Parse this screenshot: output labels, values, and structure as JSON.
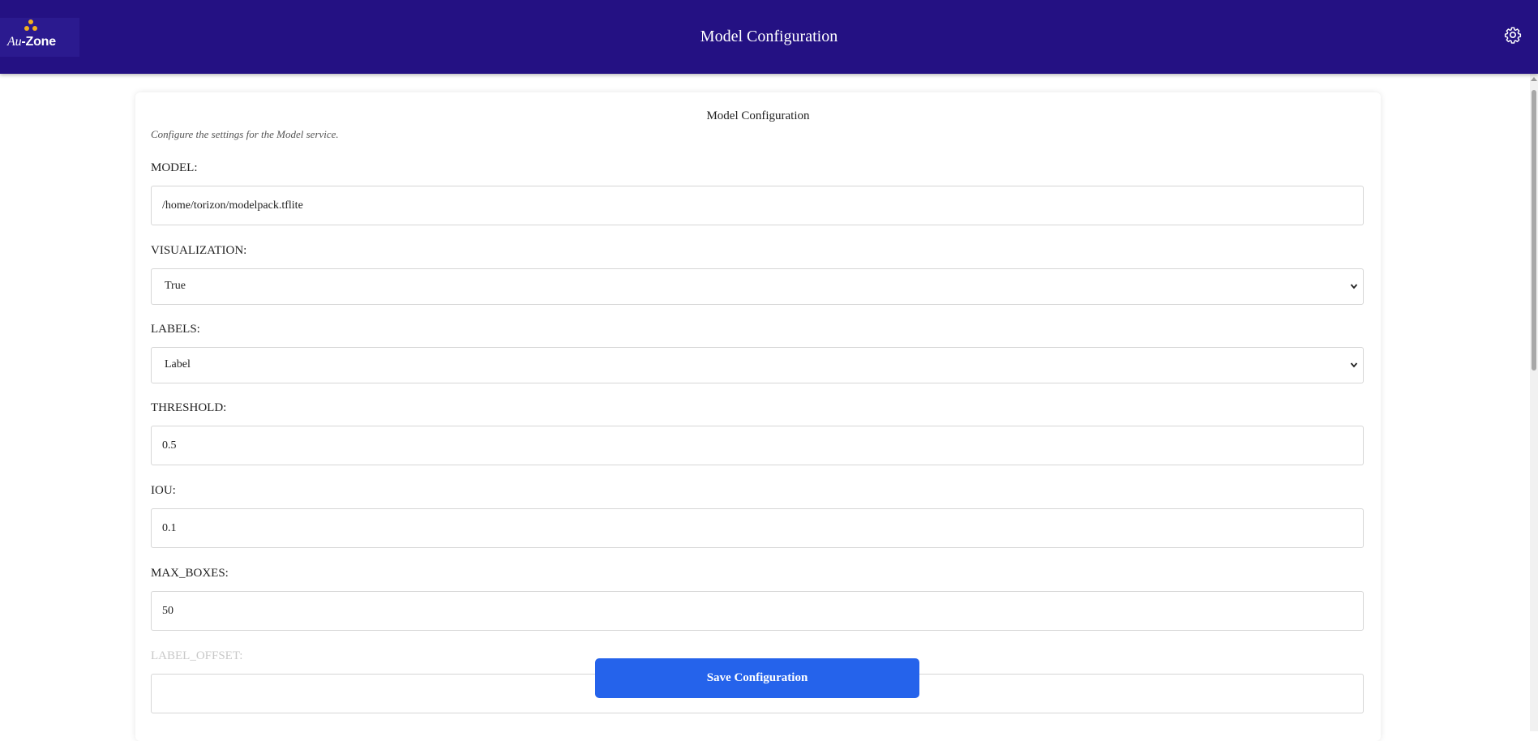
{
  "header": {
    "logo_text_au": "Au",
    "logo_text_zone": "-Zone",
    "title": "Model Configuration",
    "settings_icon": "gear-icon"
  },
  "card": {
    "title": "Model Configuration",
    "description": "Configure the settings for the Model service.",
    "fields": {
      "model": {
        "label": "MODEL:",
        "value": "/home/torizon/modelpack.tflite"
      },
      "visualization": {
        "label": "VISUALIZATION:",
        "value": "True"
      },
      "labels": {
        "label": "LABELS:",
        "value": "Label"
      },
      "threshold": {
        "label": "THRESHOLD:",
        "value": "0.5"
      },
      "iou": {
        "label": "IOU:",
        "value": "0.1"
      },
      "max_boxes": {
        "label": "MAX_BOXES:",
        "value": "50"
      },
      "label_offset": {
        "label": "LABEL_OFFSET:",
        "value": ""
      }
    }
  },
  "actions": {
    "save_label": "Save Configuration"
  },
  "colors": {
    "header_bg": "#241183",
    "button_bg": "#2563eb"
  }
}
